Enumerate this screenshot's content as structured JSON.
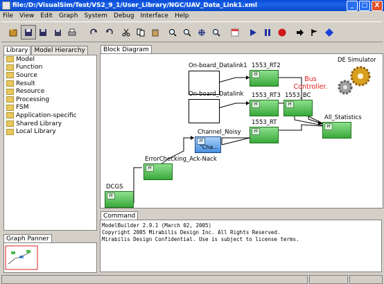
{
  "window": {
    "title": "file:/D:/VisualSim/Test/VS2_9_1/User_Library/NGC/UAV_Data_Link1.xml",
    "buttons": [
      "_",
      "□",
      "X"
    ]
  },
  "menu": [
    "File",
    "View",
    "Edit",
    "Graph",
    "System",
    "Debug",
    "Interface",
    "Help"
  ],
  "toolbar": {
    "icons": [
      "new-icon",
      "save-icon",
      "save-as-icon",
      "save-all-icon",
      "print-icon",
      "redo-icon",
      "undo-icon",
      "cut-icon",
      "copy-icon",
      "paste-icon",
      "zoom-in-icon",
      "zoom-reset-icon",
      "zoom-fit-icon",
      "zoom-out-icon",
      "calendar-icon",
      "run-icon",
      "pause-icon",
      "stop-icon",
      "step-icon",
      "flag-icon",
      "diamond-icon"
    ]
  },
  "left_tabs": [
    "Library",
    "Model Hierarchy"
  ],
  "library": [
    "Model",
    "Function",
    "Source",
    "Result",
    "Resource",
    "Processing",
    "FSM",
    "Application-specific",
    "Shared Library",
    "Local Library"
  ],
  "graph_panner": {
    "label": "Graph Panner"
  },
  "diagram": {
    "tab": "Block Diagram",
    "labels": {
      "datalink1": "On-board_Datalink1",
      "datalink": "On-board_Datalink",
      "rt2": "1553_RT2",
      "rt3": "1553_RT3",
      "bc": "1553_BC",
      "rt": "1553_RT",
      "all_stats": "All_Statistics",
      "channel": "Channel_Noisy",
      "channel_inner": "\"Cha...",
      "errorcheck": "ErrorChecking_Ack-Nack",
      "dcgs": "DCGS",
      "de_sim": "DE Simulator",
      "bus_ctrl": "Bus Controller."
    },
    "colors": {
      "bus_ctrl": "#e01818",
      "block_green": "#4cb84c",
      "channel_blue": "#5aa0e8"
    }
  },
  "command": {
    "tab": "Command",
    "lines": [
      "ModelBuilder 2.9.1 (March 02, 2005)",
      "Copyright 2005 Mirabilis Design Inc. All Rights Reserved.",
      "Mirabilis Design Confidential. Use is subject to license terms."
    ]
  }
}
